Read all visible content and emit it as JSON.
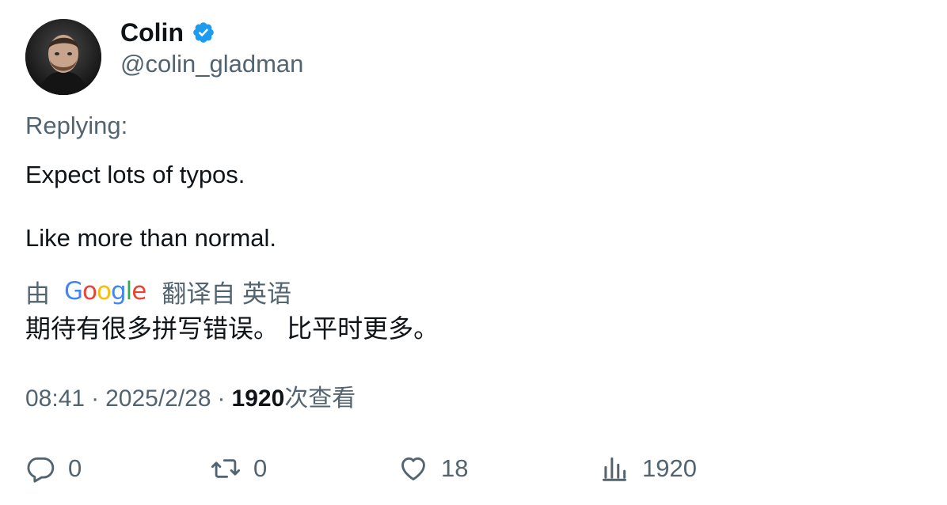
{
  "author": {
    "name": "Colin",
    "handle": "@colin_gladman",
    "verified_icon": "verified-badge-icon",
    "verified_color": "#1d9bf0"
  },
  "replying_label": "Replying:",
  "tweet": {
    "lines": [
      "Expect lots of typos.",
      "Like more than normal."
    ]
  },
  "translation": {
    "by_label": "由",
    "provider": "Google",
    "provider_letters": [
      {
        "ch": "G",
        "color": "#4285f4"
      },
      {
        "ch": "o",
        "color": "#ea4335"
      },
      {
        "ch": "o",
        "color": "#fbbc05"
      },
      {
        "ch": "g",
        "color": "#4285f4"
      },
      {
        "ch": "l",
        "color": "#34a853"
      },
      {
        "ch": "e",
        "color": "#ea4335"
      }
    ],
    "suffix_label": "翻译自 英语",
    "text": "期待有很多拼写错误。 比平时更多。"
  },
  "meta": {
    "time": "08:41",
    "separator": "·",
    "date": "2025/2/28",
    "views_count": "1920",
    "views_label": "次查看"
  },
  "actions": {
    "reply": {
      "icon": "reply-icon",
      "count": "0"
    },
    "retweet": {
      "icon": "retweet-icon",
      "count": "0"
    },
    "like": {
      "icon": "heart-icon",
      "count": "18"
    },
    "views": {
      "icon": "analytics-icon",
      "count": "1920"
    }
  },
  "colors": {
    "text_primary": "#0f1419",
    "text_secondary": "#536471"
  }
}
